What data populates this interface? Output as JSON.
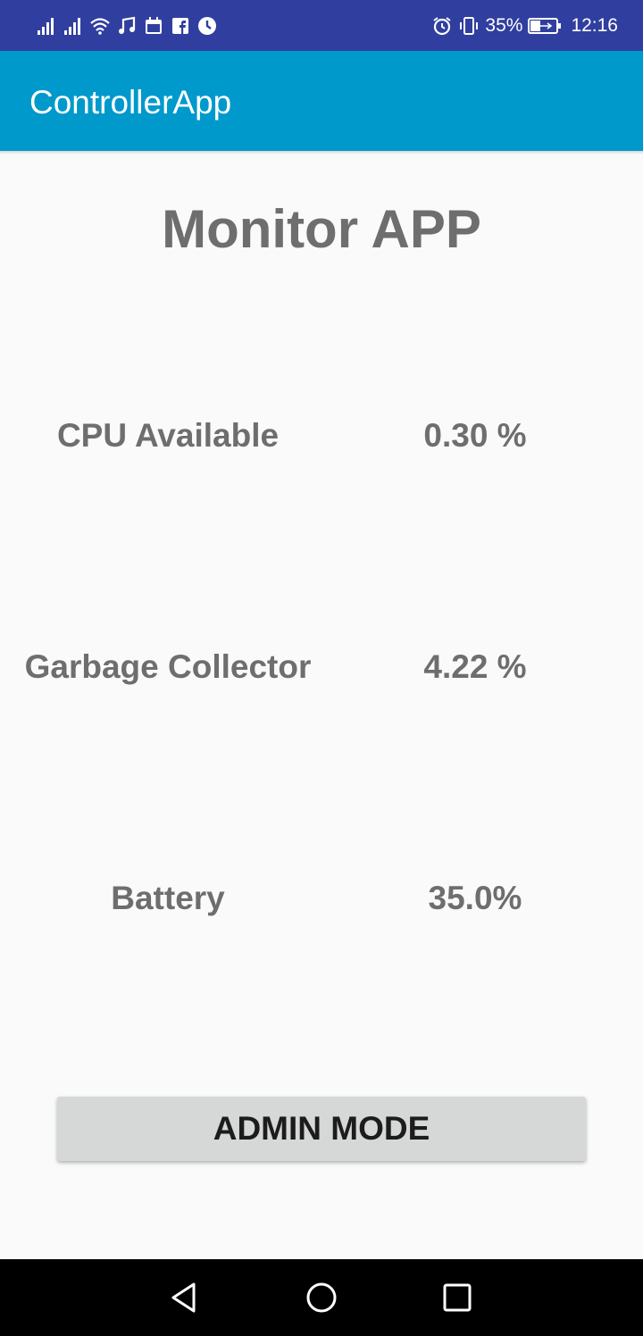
{
  "status_bar": {
    "left_icons": [
      "signal-icon",
      "signal-icon",
      "wifi-icon",
      "music-icon",
      "calendar-icon",
      "facebook-icon",
      "clock-icon"
    ],
    "battery_percent": "35%",
    "time": "12:16",
    "right_icons": [
      "alarm-icon",
      "vibrate-icon",
      "battery-icon"
    ]
  },
  "app_bar": {
    "title": "ControllerApp",
    "background": "#0099cc"
  },
  "main": {
    "heading": "Monitor APP",
    "metrics": [
      {
        "label": "CPU Available",
        "value": "0.30 %"
      },
      {
        "label": "Garbage Collector",
        "value": "4.22 %"
      },
      {
        "label": "Battery",
        "value": "35.0%"
      }
    ],
    "admin_button": "ADMIN MODE"
  },
  "nav_bar": {
    "icons": [
      "back-icon",
      "home-icon",
      "recents-icon"
    ]
  },
  "colors": {
    "status_bar": "#303f9f",
    "app_bar": "#0099cc",
    "text": "#6e6e6e",
    "button": "#d6d7d7"
  }
}
